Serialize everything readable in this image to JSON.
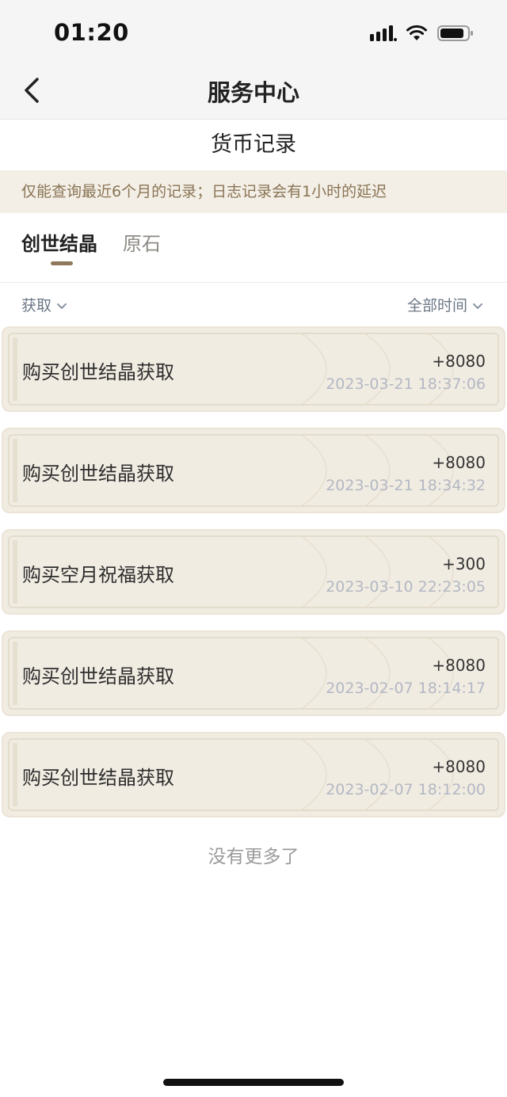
{
  "status_bar": {
    "time": "01:20"
  },
  "nav": {
    "title": "服务中心",
    "back_icon": "chevron-left-icon"
  },
  "page_header": "货币记录",
  "notice": "仅能查询最近6个月的记录；日志记录会有1小时的延迟",
  "tabs": [
    {
      "label": "创世结晶",
      "active": true
    },
    {
      "label": "原石",
      "active": false
    }
  ],
  "filters": {
    "type": "获取",
    "time": "全部时间"
  },
  "records": [
    {
      "title": "购买创世结晶获取",
      "amount": "+8080",
      "time": "2023-03-21 18:37:06"
    },
    {
      "title": "购买创世结晶获取",
      "amount": "+8080",
      "time": "2023-03-21 18:34:32"
    },
    {
      "title": "购买空月祝福获取",
      "amount": "+300",
      "time": "2023-03-10 22:23:05"
    },
    {
      "title": "购买创世结晶获取",
      "amount": "+8080",
      "time": "2023-02-07 18:14:17"
    },
    {
      "title": "购买创世结晶获取",
      "amount": "+8080",
      "time": "2023-02-07 18:12:00"
    }
  ],
  "footer": "没有更多了",
  "colors": {
    "accent": "#8e7a5a",
    "card_bg": "#f1ece2",
    "notice_bg": "#f3efe6"
  }
}
